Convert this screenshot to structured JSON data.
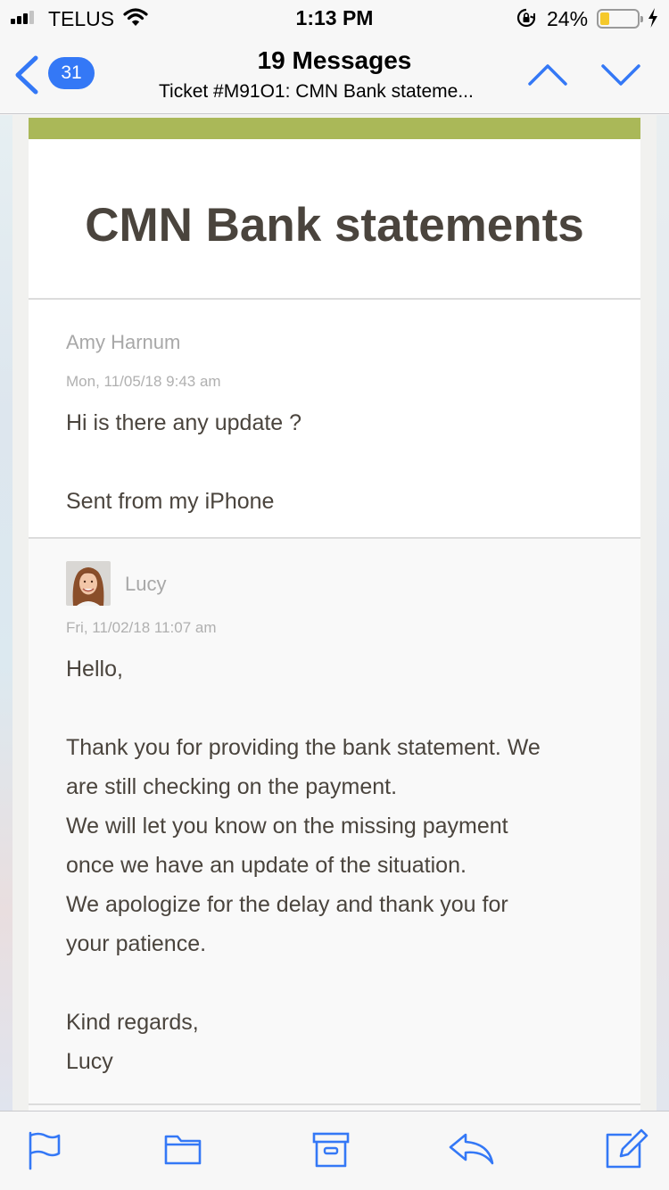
{
  "status_bar": {
    "carrier": "TELUS",
    "time": "1:13 PM",
    "battery_percent": "24%",
    "battery_level": 0.24,
    "signal_bars": 3
  },
  "nav": {
    "back_count": "31",
    "title": "19 Messages",
    "subtitle": "Ticket #M91O1: CMN  Bank stateme..."
  },
  "ticket": {
    "subject": "CMN Bank statements",
    "accent_color": "#aab858"
  },
  "messages": [
    {
      "sender": "Amy Harnum",
      "date": "Mon, 11/05/18 9:43 am",
      "lines": [
        "Hi is there any update ?",
        "",
        "Sent from my iPhone"
      ]
    },
    {
      "sender": "Lucy",
      "date": "Fri, 11/02/18 11:07 am",
      "lines": [
        "Hello,",
        "",
        "Thank you for providing the bank statement. We",
        "are still checking on the payment.",
        "We will let you know on the missing payment",
        "once we have an update of the situation.",
        "We apologize for the delay and thank you for",
        "your patience.",
        "",
        "Kind regards,",
        "Lucy"
      ]
    }
  ],
  "icons": {
    "back": "chevron-left-icon",
    "prev": "chevron-up-icon",
    "next": "chevron-down-icon",
    "flag": "flag-icon",
    "folder": "folder-icon",
    "archive": "archive-icon",
    "reply": "reply-icon",
    "compose": "compose-icon"
  },
  "colors": {
    "ios_blue": "#3478f6",
    "text": "#4a443d"
  }
}
